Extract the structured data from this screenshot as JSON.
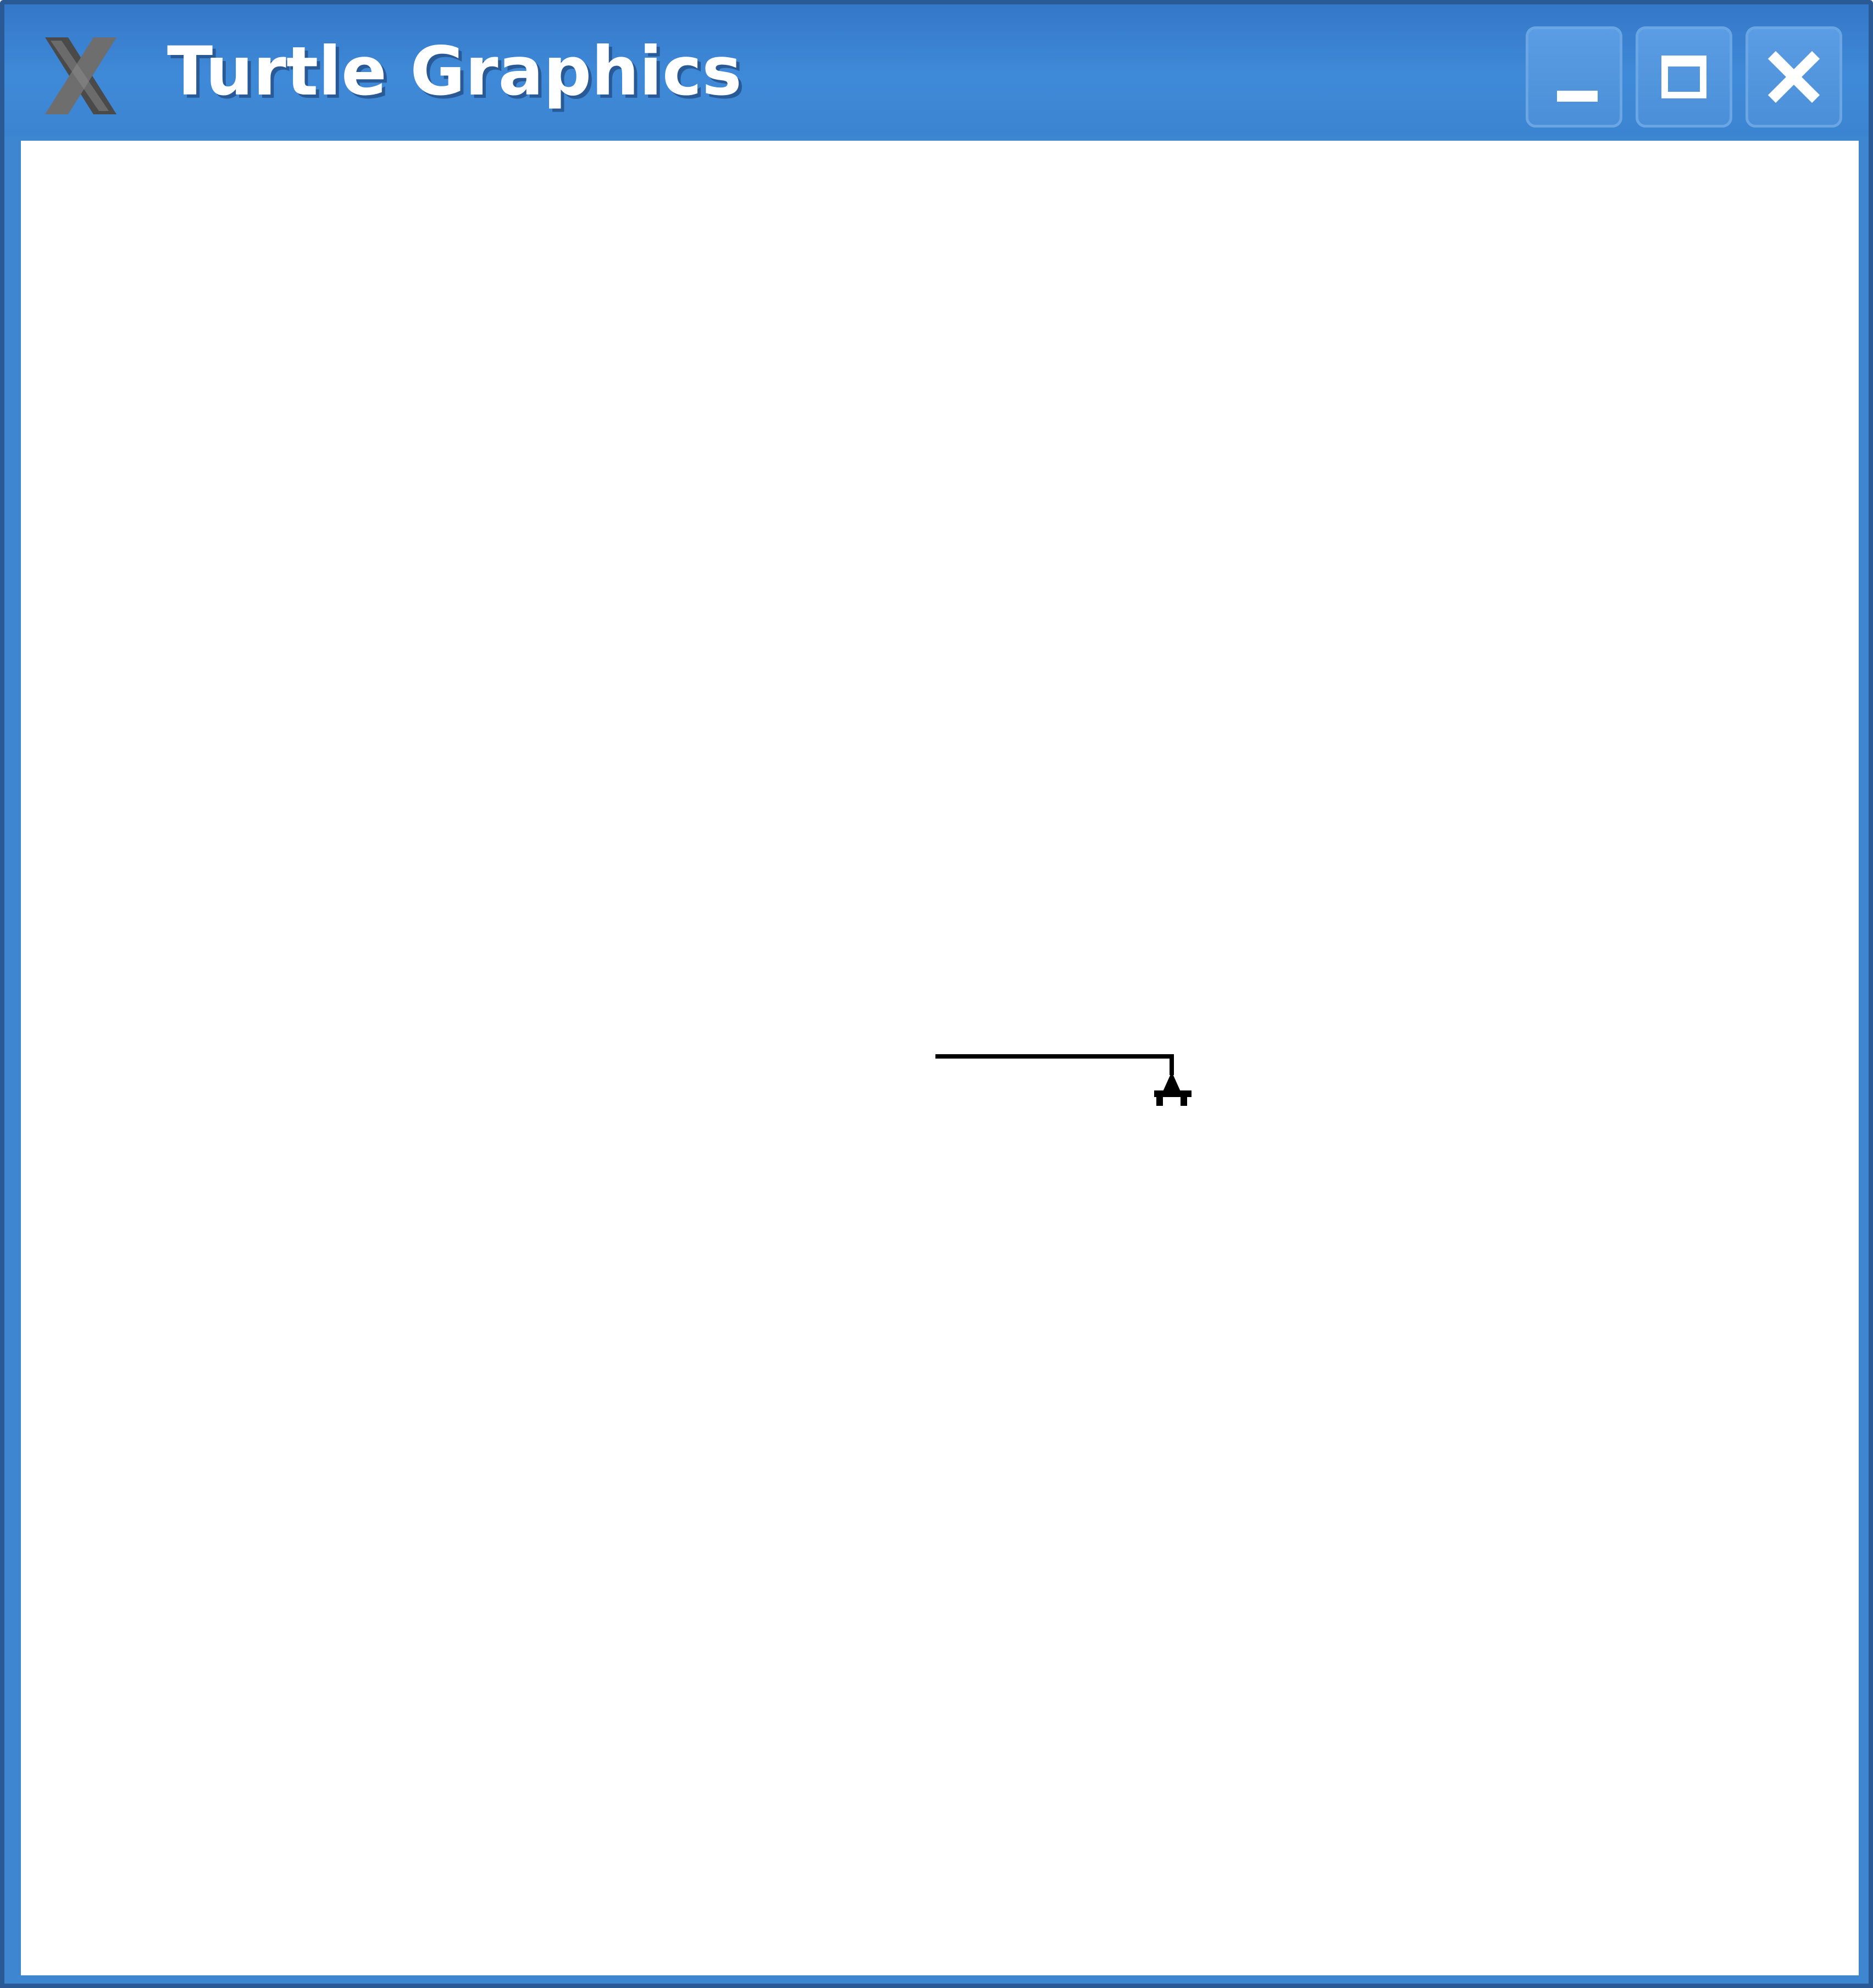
{
  "window": {
    "title": "Turtle Graphics",
    "app_icon": "x-logo-icon",
    "controls": {
      "minimize_icon": "minimize-icon",
      "maximize_icon": "maximize-icon",
      "close_icon": "close-icon"
    }
  },
  "canvas": {
    "background": "#ffffff",
    "turtle_icon": "turtle-arrow-icon",
    "pen_color": "#000000"
  },
  "colors": {
    "titlebar": "#3f86d0",
    "border": "#2a5a96",
    "title_text": "#ffffff"
  }
}
